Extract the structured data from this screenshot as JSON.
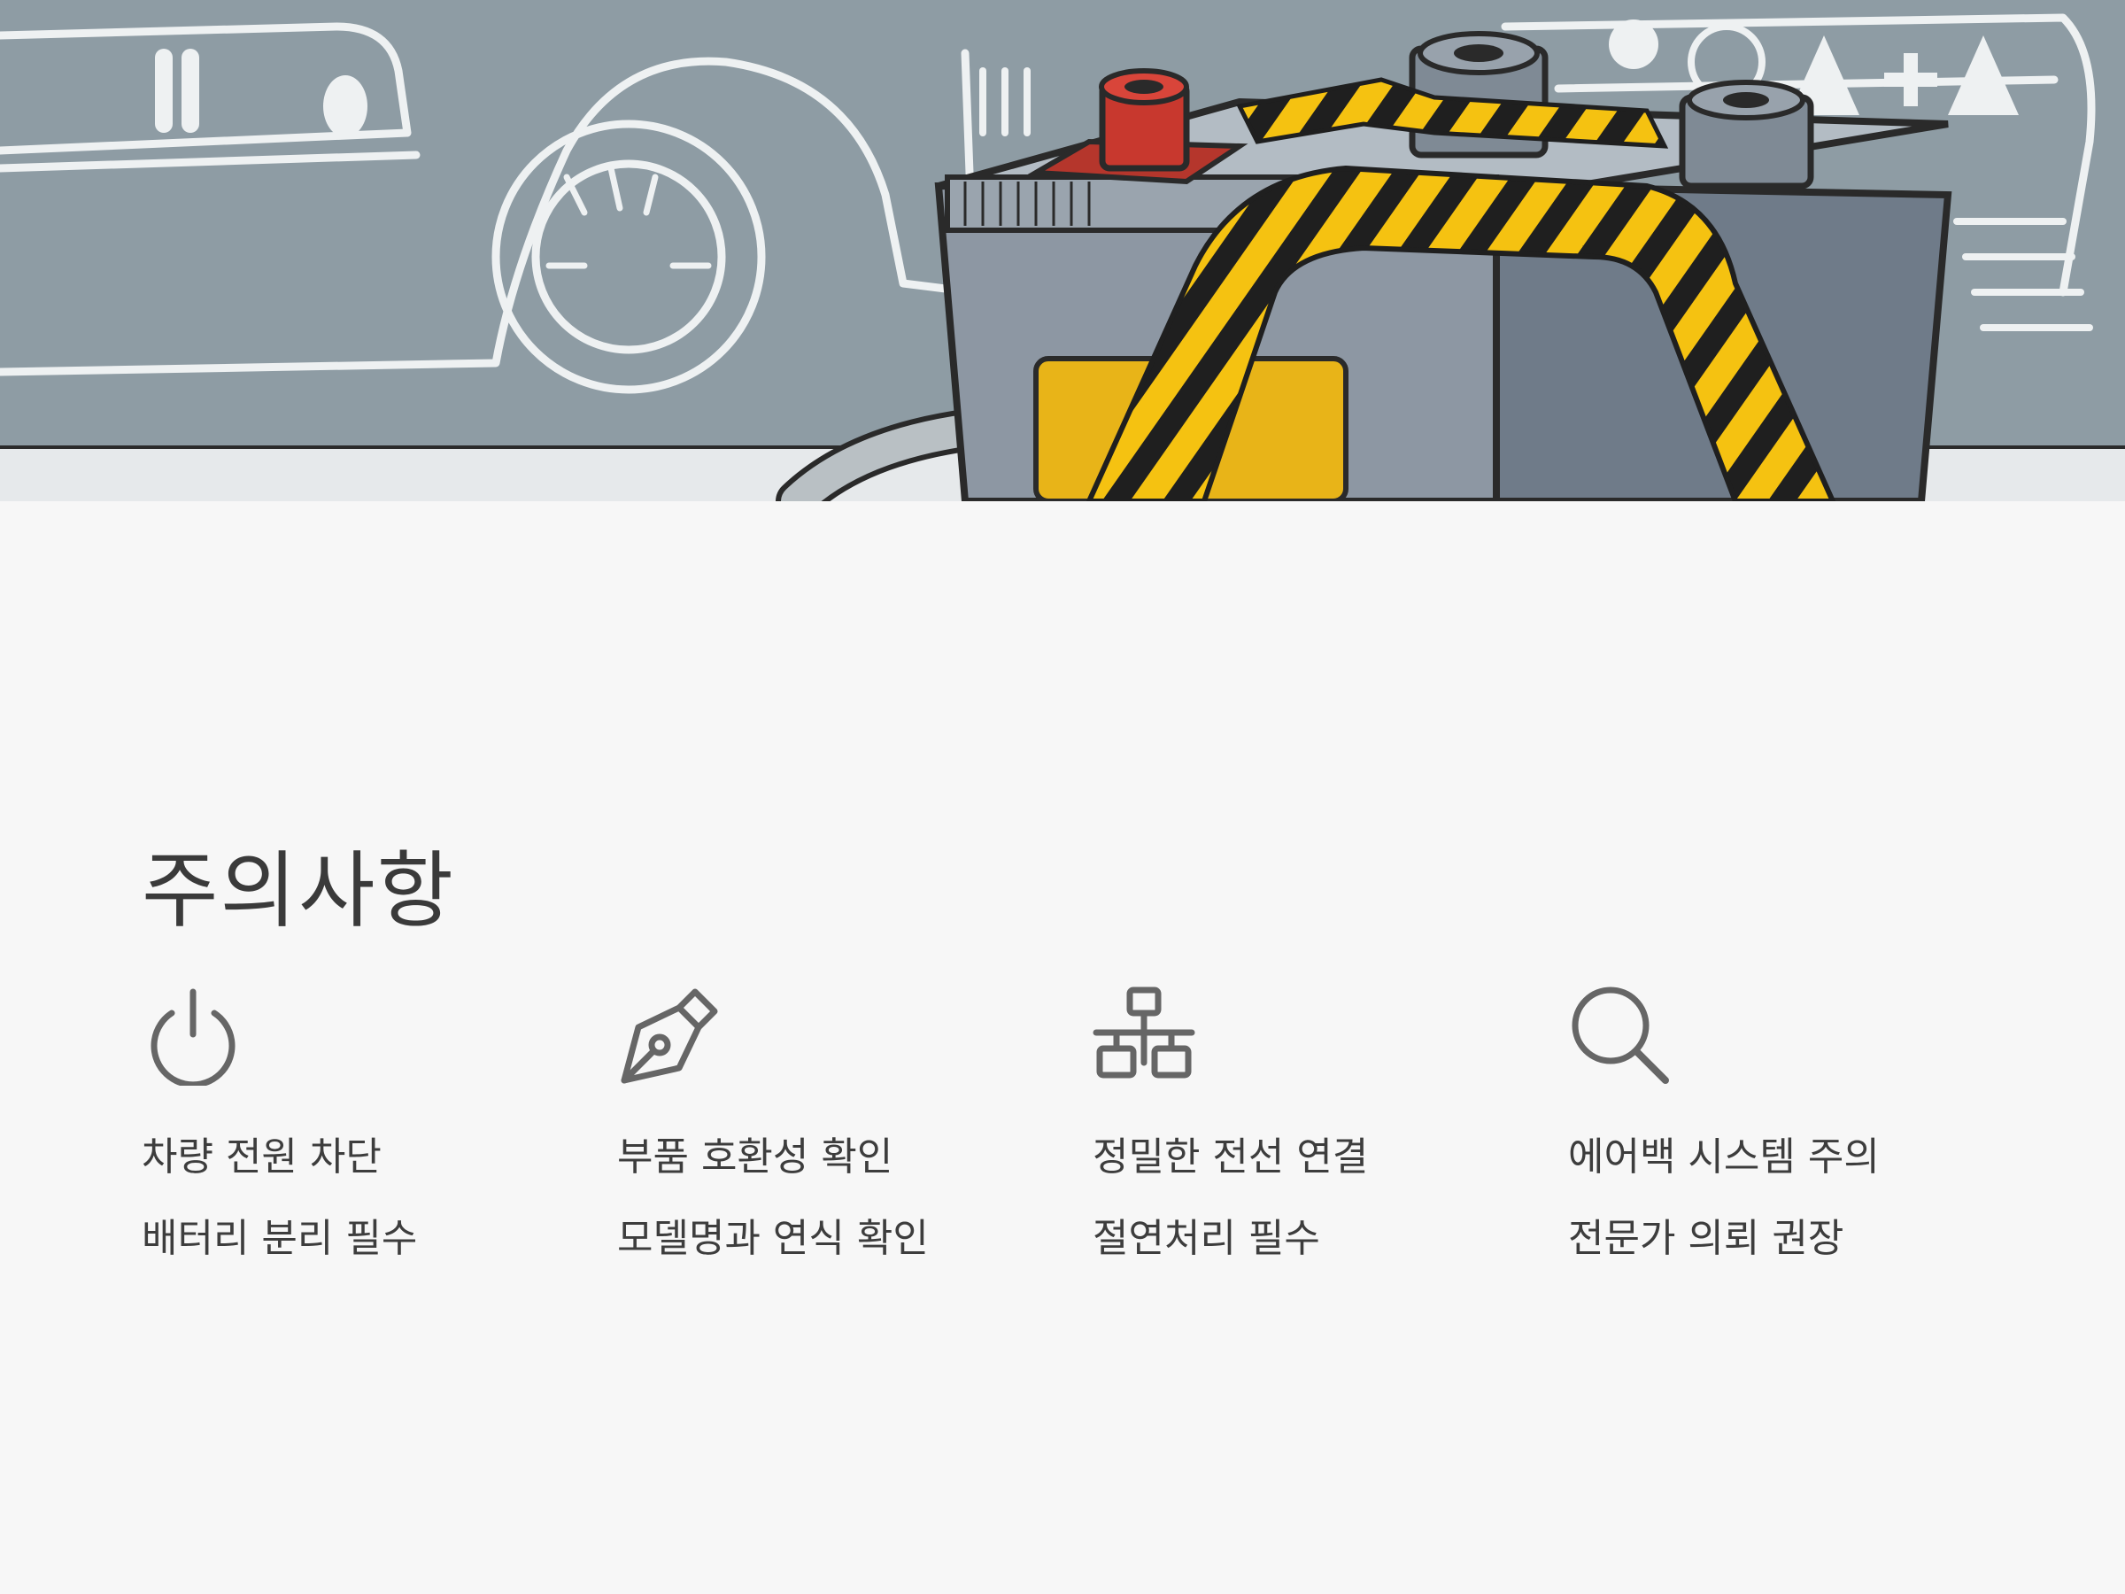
{
  "hero": {
    "illustration": "car-battery-with-hazard-tape"
  },
  "title": "주의사항",
  "items": [
    {
      "icon": "power-icon",
      "line1": "차량 전원 차단",
      "line2": "배터리 분리 필수"
    },
    {
      "icon": "pen-nib-icon",
      "line1": "부품 호환성 확인",
      "line2": "모델명과 연식 확인"
    },
    {
      "icon": "network-icon",
      "line1": "정밀한 전선 연결",
      "line2": "절연처리 필수"
    },
    {
      "icon": "search-icon",
      "line1": "에어백 시스템 주의",
      "line2": "전문가 의뢰 권장"
    }
  ],
  "colors": {
    "background": "#f7f7f7",
    "hero_bg": "#8d9ba3",
    "text": "#3a3a3a",
    "icon": "#666666",
    "hazard_yellow": "#f5c211",
    "terminal_red": "#c0392b"
  }
}
